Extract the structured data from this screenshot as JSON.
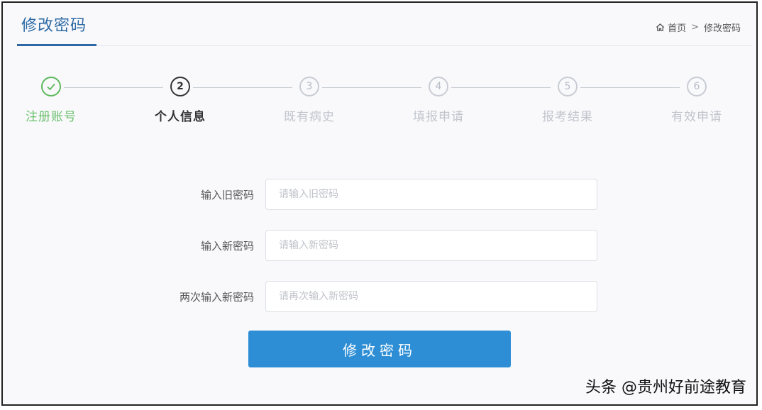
{
  "header": {
    "title": "修改密码",
    "breadcrumb": {
      "home": "首页",
      "separator": ">",
      "current": "修改密码"
    }
  },
  "steps": [
    {
      "number": "✓",
      "label": "注册账号",
      "state": "done"
    },
    {
      "number": "2",
      "label": "个人信息",
      "state": "active"
    },
    {
      "number": "3",
      "label": "既有病史",
      "state": "pending"
    },
    {
      "number": "4",
      "label": "填报申请",
      "state": "pending"
    },
    {
      "number": "5",
      "label": "报考结果",
      "state": "pending"
    },
    {
      "number": "6",
      "label": "有效申请",
      "state": "pending"
    }
  ],
  "form": {
    "old_password": {
      "label": "输入旧密码",
      "placeholder": "请输入旧密码",
      "value": ""
    },
    "new_password": {
      "label": "输入新密码",
      "placeholder": "请输入新密码",
      "value": ""
    },
    "confirm_password": {
      "label": "两次输入新密码",
      "placeholder": "请再次输入新密码",
      "value": ""
    },
    "submit_label": "修改密码"
  },
  "watermark": "头条 @贵州好前途教育",
  "colors": {
    "accent": "#2d6aa3",
    "button": "#2d8ed6",
    "done": "#5cb85c"
  }
}
